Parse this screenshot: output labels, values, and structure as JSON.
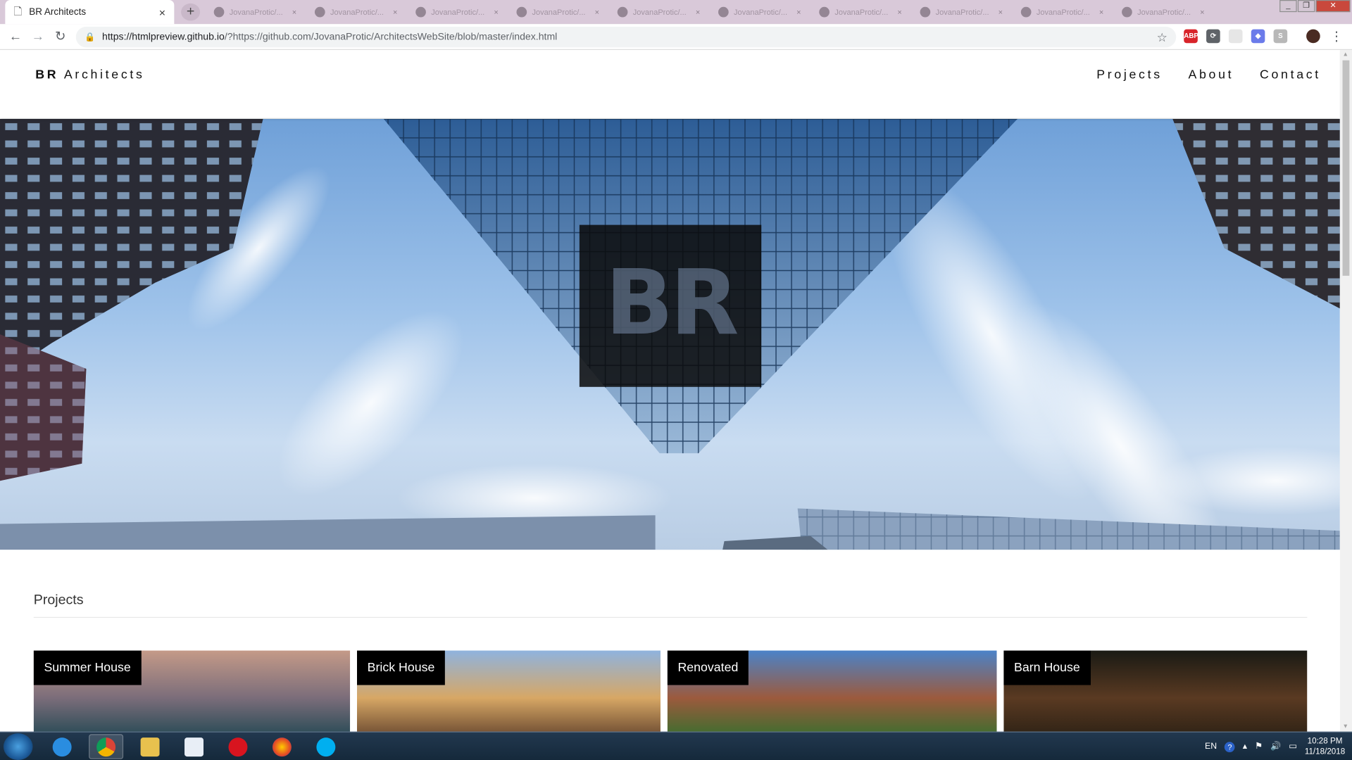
{
  "browser": {
    "tab_title": "BR Architects",
    "new_tab_symbol": "+",
    "close_tab_symbol": "×",
    "background_tab_label": "JovanaProtic/...",
    "url_host": "https://htmlpreview.github.io",
    "url_rest": "/?https://github.com/JovanaProtic/ArchitectsWebSite/blob/master/index.html",
    "icons": [
      "back-icon",
      "forward-icon",
      "reload-icon",
      "lock-icon",
      "star-icon",
      "menu-icon"
    ],
    "extensions": [
      {
        "name": "adblock-extension-icon",
        "text": "ABP",
        "color": "#d8242a"
      },
      {
        "name": "sync-extension-icon",
        "text": "⟳",
        "color": "#5f6368"
      },
      {
        "name": "blank-extension-icon",
        "text": "",
        "color": "#e6e6e6"
      },
      {
        "name": "shield-extension-icon",
        "text": "◆",
        "color": "#6b7bea"
      },
      {
        "name": "skype-extension-icon",
        "text": "S",
        "color": "#b8b8b8"
      },
      {
        "name": "profile-avatar-icon",
        "text": "",
        "color": "#4a2b22"
      }
    ]
  },
  "site": {
    "brand_bold": "BR",
    "brand_rest": "Architects",
    "nav": [
      "Projects",
      "About",
      "Contact"
    ],
    "hero_logo": "BR",
    "projects_heading": "Projects",
    "projects": [
      {
        "label": "Summer House",
        "colors": [
          "#c49a88",
          "#7b6d7a",
          "#274a55"
        ]
      },
      {
        "label": "Brick House",
        "colors": [
          "#8fb3de",
          "#d7a765",
          "#6b4a30"
        ]
      },
      {
        "label": "Renovated",
        "colors": [
          "#4b83c8",
          "#9c5a3d",
          "#3b6e2e"
        ]
      },
      {
        "label": "Barn House",
        "colors": [
          "#1a1a14",
          "#5a3a22",
          "#2e2215"
        ]
      }
    ]
  },
  "taskbar": {
    "apps": [
      "internet-explorer-icon",
      "chrome-icon",
      "file-explorer-icon",
      "notepad-icon",
      "opera-icon",
      "firefox-icon",
      "skype-icon"
    ],
    "language": "EN",
    "time": "10:28 PM",
    "date": "11/18/2018"
  }
}
